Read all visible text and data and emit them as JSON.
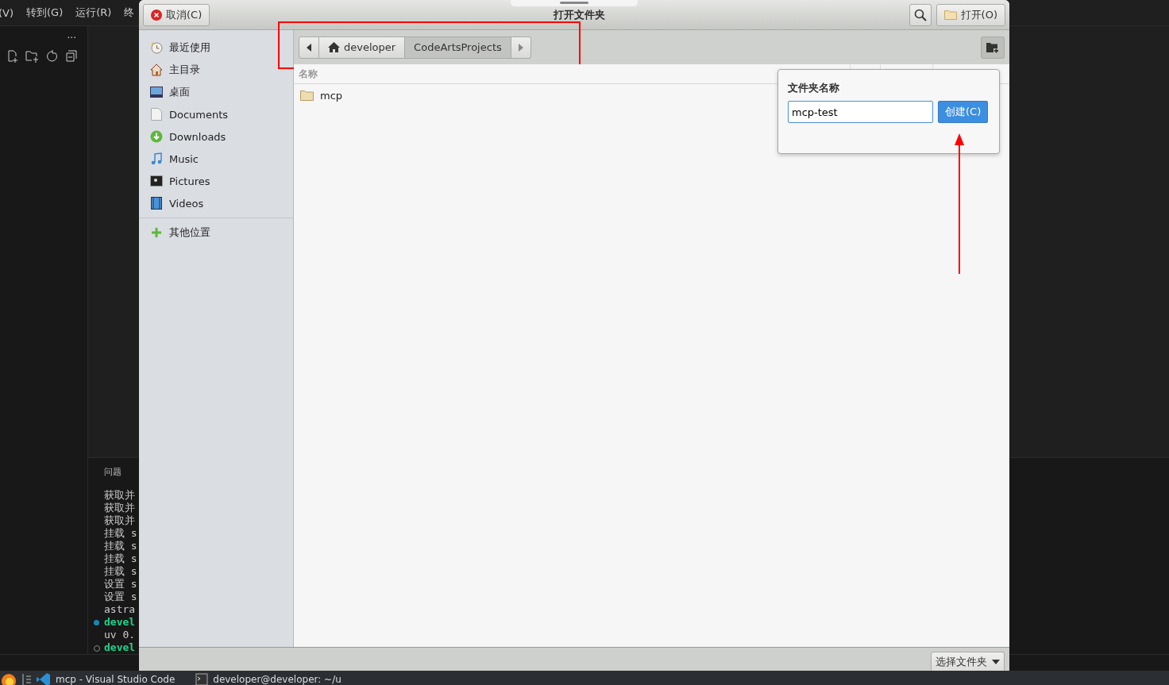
{
  "editor": {
    "menu": [
      "(V)",
      "转到(G)",
      "运行(R)",
      "终"
    ],
    "more": "···",
    "panel_tab": "问题",
    "terminal_lines": [
      {
        "text": "获取并",
        "kind": "plain"
      },
      {
        "text": "获取并",
        "kind": "plain"
      },
      {
        "text": "获取并",
        "kind": "plain"
      },
      {
        "text": "挂载 s",
        "kind": "plain"
      },
      {
        "text": "挂载 s",
        "kind": "plain"
      },
      {
        "text": "挂载 s",
        "kind": "plain"
      },
      {
        "text": "挂载 s",
        "kind": "plain"
      },
      {
        "text": "设置 s",
        "kind": "plain"
      },
      {
        "text": "设置 s",
        "kind": "plain"
      },
      {
        "text": "astra",
        "kind": "plain"
      },
      {
        "text": "devel",
        "kind": "prompt-active"
      },
      {
        "text": "uv 0.",
        "kind": "plain"
      },
      {
        "text": "devel",
        "kind": "prompt-idle"
      }
    ]
  },
  "dialog": {
    "title": "打开文件夹",
    "cancel": "取消(C)",
    "open": "打开(O)",
    "places": [
      {
        "label": "最近使用",
        "kind": "recent",
        "selected": false
      },
      {
        "label": "主目录",
        "kind": "home",
        "selected": false
      },
      {
        "label": "桌面",
        "kind": "desktop",
        "selected": false
      },
      {
        "label": "Documents",
        "kind": "documents",
        "selected": false
      },
      {
        "label": "Downloads",
        "kind": "downloads",
        "selected": false
      },
      {
        "label": "Music",
        "kind": "music",
        "selected": false
      },
      {
        "label": "Pictures",
        "kind": "pictures",
        "selected": false
      },
      {
        "label": "Videos",
        "kind": "videos",
        "selected": false
      }
    ],
    "other_places": "其他位置",
    "path": [
      {
        "label": "developer",
        "home": true,
        "selected": false
      },
      {
        "label": "CodeArtsProjects",
        "home": false,
        "selected": true
      }
    ],
    "column_header": "名称",
    "files": [
      {
        "name": "mcp"
      }
    ],
    "new_folder_popover": {
      "label": "文件夹名称",
      "value": "mcp-test",
      "create": "创建(C)"
    },
    "filter": "选择文件夹"
  },
  "taskbar": {
    "items": [
      "mcp - Visual Studio Code",
      "developer@developer: ~/u"
    ]
  }
}
